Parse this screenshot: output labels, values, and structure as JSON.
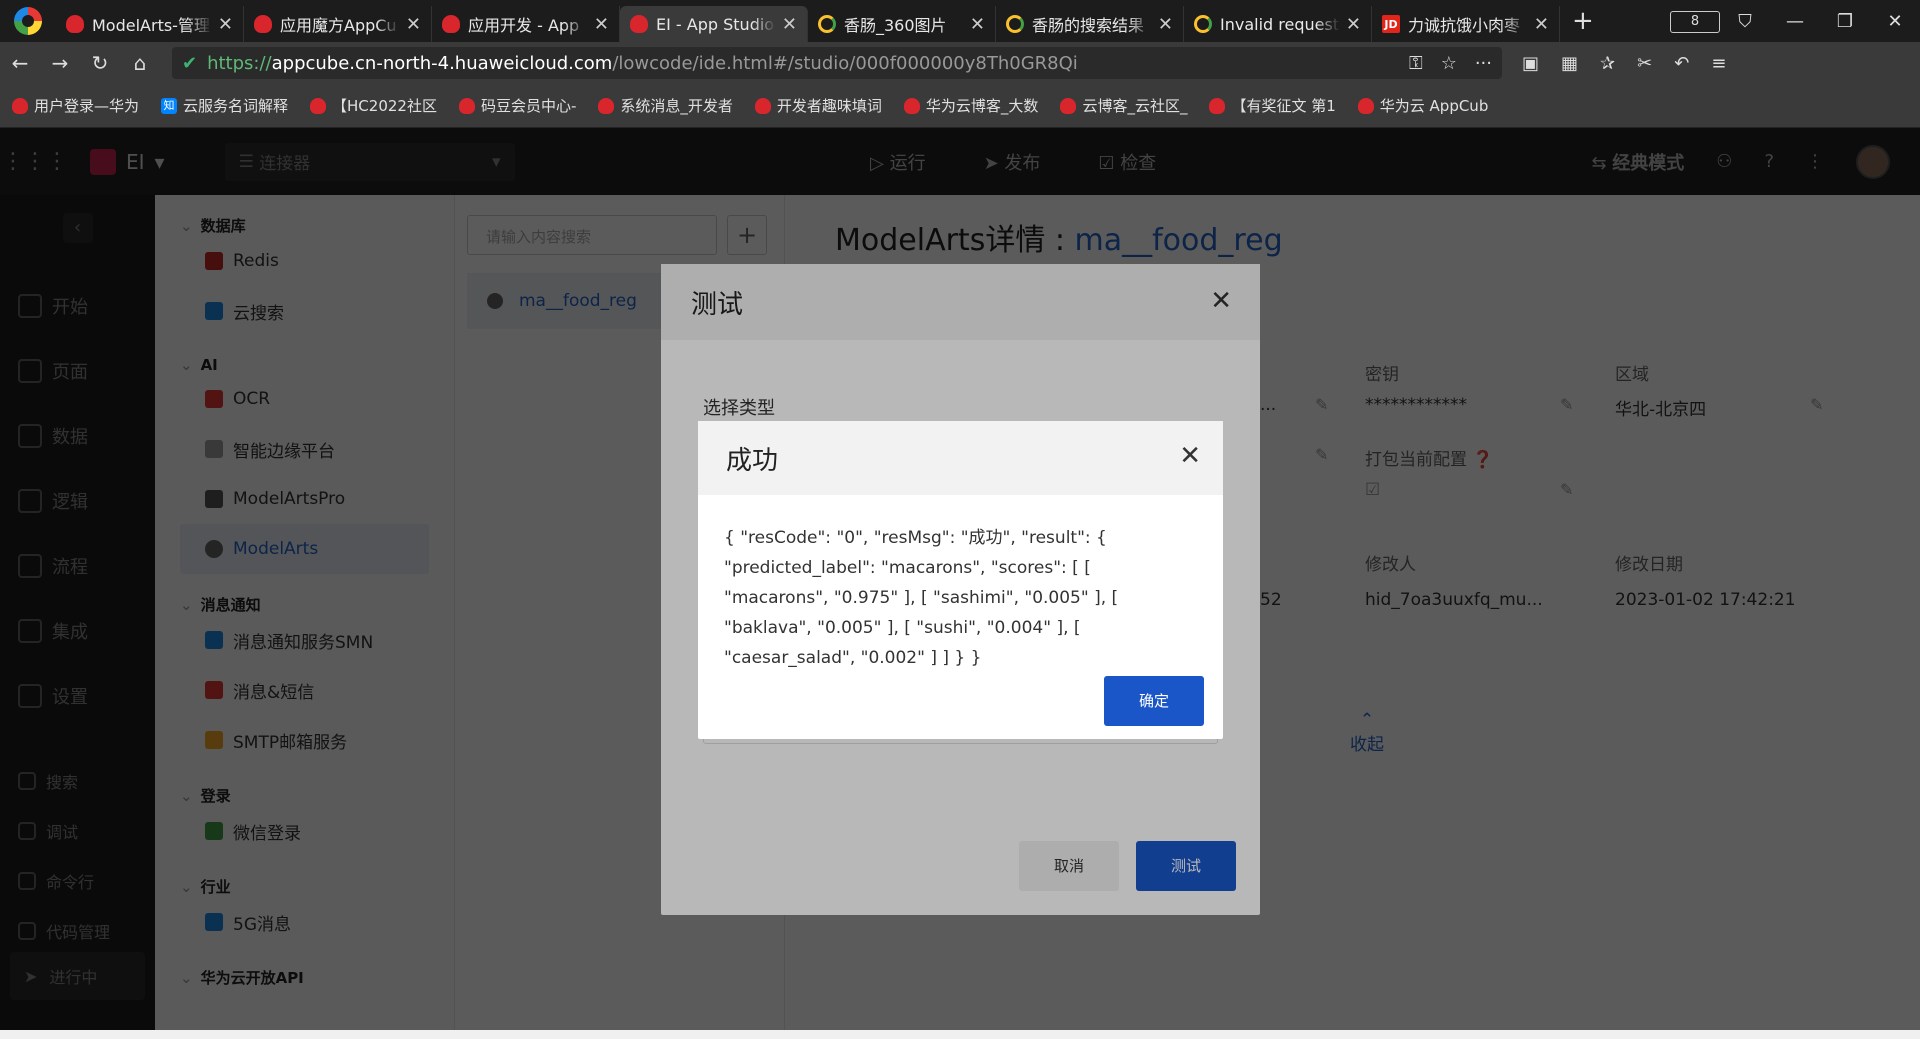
{
  "browser": {
    "tabs": [
      {
        "title": "ModelArts-管理",
        "favicon": "huawei-icon",
        "active": false
      },
      {
        "title": "应用魔方AppCu",
        "favicon": "huawei-icon",
        "active": false
      },
      {
        "title": "应用开发 - App",
        "favicon": "huawei-icon",
        "active": false
      },
      {
        "title": "EI - App Studio",
        "favicon": "huawei-icon",
        "active": true
      },
      {
        "title": "香肠_360图片",
        "favicon": "search-icon",
        "active": false
      },
      {
        "title": "香肠的搜索结果",
        "favicon": "search-icon",
        "active": false
      },
      {
        "title": "Invalid request",
        "favicon": "search-icon",
        "active": false
      },
      {
        "title": "力诚抗饿小肉枣",
        "favicon": "jd-icon",
        "active": false
      }
    ],
    "tab_count": "8",
    "url": {
      "protocol": "https://",
      "host": "appcube.cn-north-4.huaweicloud.com",
      "path": "/lowcode/ide.html#/studio/000f000000y8Th0GR8Qi"
    },
    "bookmarks": [
      "用户登录—华为",
      "云服务名词解释",
      "【HC2022社区",
      "码豆会员中心-",
      "系统消息_开发者",
      "开发者趣味填词",
      "华为云博客_大数",
      "云博客_云社区_",
      "【有奖征文 第1",
      "华为云 AppCub"
    ]
  },
  "app": {
    "project": "EI",
    "connector_placeholder": "连接器",
    "top_actions": [
      "运行",
      "发布",
      "检查"
    ],
    "mode": "经典模式",
    "left_nav": [
      "开始",
      "页面",
      "数据",
      "逻辑",
      "流程",
      "集成",
      "设置"
    ],
    "left_nav_small": [
      "搜索",
      "调试",
      "命令行",
      "代码管理"
    ],
    "running_label": "进行中",
    "palette": [
      {
        "group": "数据库",
        "items": [
          "Redis",
          "云搜索"
        ]
      },
      {
        "group": "AI",
        "items": [
          "OCR",
          "智能边缘平台",
          "ModelArtsPro",
          "ModelArts"
        ]
      },
      {
        "group": "消息通知",
        "items": [
          "消息通知服务SMN",
          "消息&短信",
          "SMTP邮箱服务"
        ]
      },
      {
        "group": "登录",
        "items": [
          "微信登录"
        ]
      },
      {
        "group": "行业",
        "items": [
          "5G消息"
        ]
      },
      {
        "group": "华为云开放API",
        "items": []
      }
    ],
    "selected_palette_item": "ModelArts",
    "search_placeholder": "请输入内容搜索",
    "list_item": "ma__food_reg",
    "detail": {
      "title_prefix": "ModelArts详情 : ",
      "title_name": "ma__food_reg",
      "labels": {
        "secret": "密钥",
        "region": "区域",
        "pack": "打包当前配置",
        "modifier": "修改人",
        "modified": "修改日期"
      },
      "values": {
        "secret": "************",
        "region": "华北-北京四",
        "modifier": "hid_7oa3uuxfq_mu...",
        "modified": "2023-01-02 17:42:21",
        "partial": "52",
        "ellipsis": "..."
      },
      "fold": "收起"
    }
  },
  "test_dialog": {
    "title": "测试",
    "select_type_label": "选择类型",
    "cancel": "取消",
    "test": "测试"
  },
  "success_dialog": {
    "title": "成功",
    "body": "{ \"resCode\": \"0\", \"resMsg\": \"成功\", \"result\": { \"predicted_label\": \"macarons\", \"scores\": [ [ \"macarons\", \"0.975\" ], [ \"sashimi\", \"0.005\" ], [ \"baklava\", \"0.005\" ], [ \"sushi\", \"0.004\" ], [ \"caesar_salad\", \"0.002\" ] ] } }",
    "ok": "确定"
  },
  "colors": {
    "primary": "#1a56c8",
    "link": "#2566c8"
  }
}
